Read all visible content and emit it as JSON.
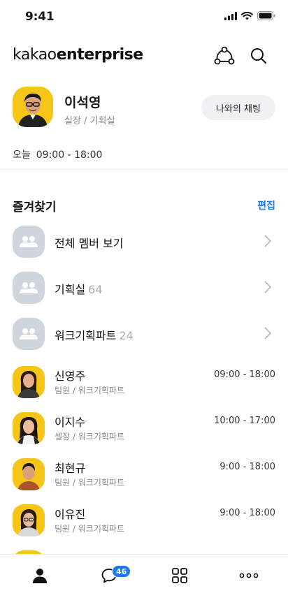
{
  "status_bar": {
    "time": "9:41"
  },
  "header": {
    "brand_light": "kakao",
    "brand_bold": "enterprise"
  },
  "profile": {
    "name": "이석영",
    "role": "실장 / 기획실",
    "chat_button": "나와의 채팅",
    "worktime_label": "오늘",
    "worktime_value": "09:00 - 18:00"
  },
  "favorites": {
    "title": "즐겨찾기",
    "edit_label": "편집",
    "groups": [
      {
        "name": "전체 멤버 보기",
        "count": ""
      },
      {
        "name": "기획실",
        "count": "64"
      },
      {
        "name": "워크기획파트",
        "count": "24"
      }
    ],
    "people": [
      {
        "name": "신영주",
        "role": "팀원 / 워크기획파트",
        "hours": "09:00 - 18:00"
      },
      {
        "name": "이지수",
        "role": "셀장 / 워크기획파트",
        "hours": "10:00 - 17:00"
      },
      {
        "name": "최현규",
        "role": "팀원 / 워크기획파트",
        "hours": "9:00 - 18:00"
      },
      {
        "name": "이유진",
        "role": "팀원 / 워크기획파트",
        "hours": "9:00 - 18:00"
      }
    ]
  },
  "tab_bar": {
    "badge": "46",
    "tabs": [
      "person-icon",
      "chat-icon",
      "grid-icon",
      "more-icon"
    ]
  },
  "colors": {
    "accent": "#1a7cf5",
    "avatar_bg": "#f5c518",
    "group_bg": "#cfd5dc"
  }
}
